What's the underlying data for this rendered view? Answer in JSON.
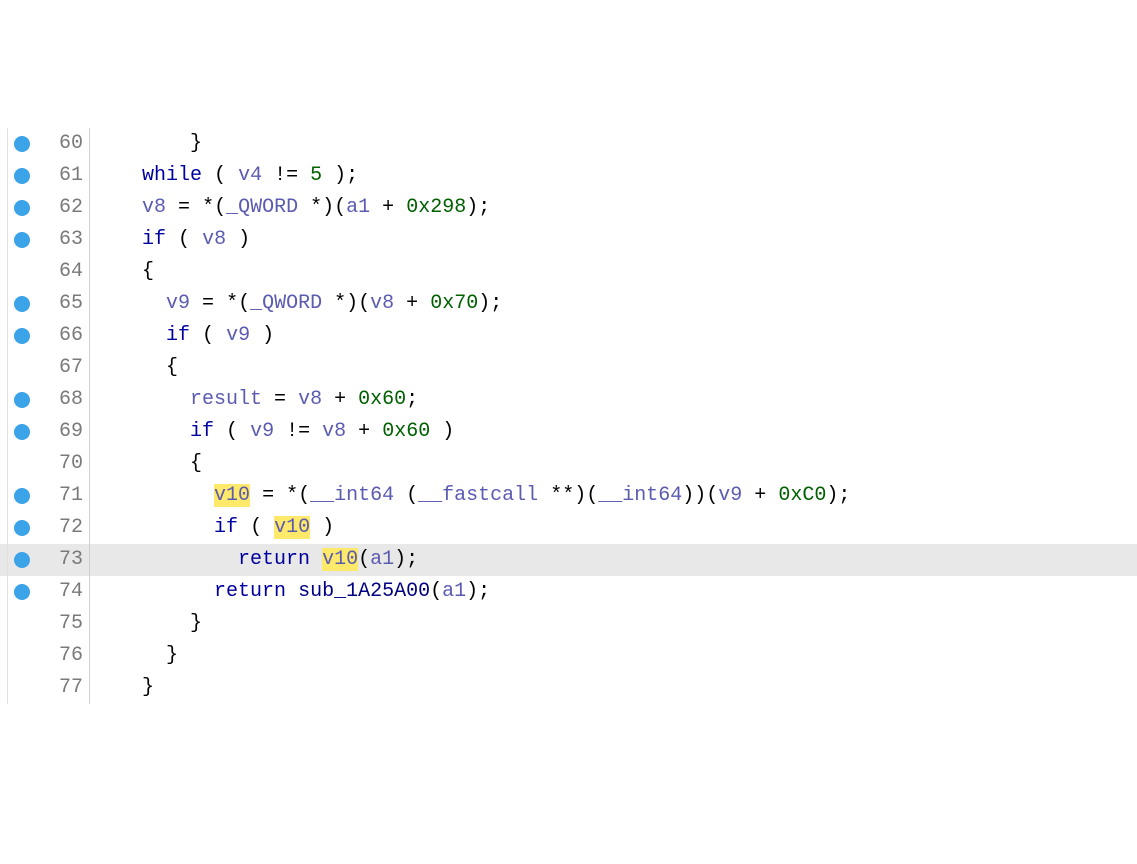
{
  "lines": [
    {
      "num": 60,
      "bp": true,
      "hl": false,
      "tokens": [
        [
          "plain",
          "        "
        ],
        [
          "punc",
          "}"
        ]
      ]
    },
    {
      "num": 61,
      "bp": true,
      "hl": false,
      "tokens": [
        [
          "plain",
          "    "
        ],
        [
          "kw",
          "while"
        ],
        [
          "plain",
          " "
        ],
        [
          "punc",
          "("
        ],
        [
          "plain",
          " "
        ],
        [
          "var",
          "v4"
        ],
        [
          "plain",
          " "
        ],
        [
          "punc",
          "!="
        ],
        [
          "plain",
          " "
        ],
        [
          "num",
          "5"
        ],
        [
          "plain",
          " "
        ],
        [
          "punc",
          ");"
        ]
      ]
    },
    {
      "num": 62,
      "bp": true,
      "hl": false,
      "tokens": [
        [
          "plain",
          "    "
        ],
        [
          "var",
          "v8"
        ],
        [
          "plain",
          " "
        ],
        [
          "punc",
          "="
        ],
        [
          "plain",
          " "
        ],
        [
          "punc",
          "*("
        ],
        [
          "type",
          "_QWORD"
        ],
        [
          "plain",
          " "
        ],
        [
          "punc",
          "*)("
        ],
        [
          "var",
          "a1"
        ],
        [
          "plain",
          " "
        ],
        [
          "punc",
          "+"
        ],
        [
          "plain",
          " "
        ],
        [
          "num",
          "0x298"
        ],
        [
          "punc",
          ");"
        ]
      ]
    },
    {
      "num": 63,
      "bp": true,
      "hl": false,
      "tokens": [
        [
          "plain",
          "    "
        ],
        [
          "kw",
          "if"
        ],
        [
          "plain",
          " "
        ],
        [
          "punc",
          "("
        ],
        [
          "plain",
          " "
        ],
        [
          "var",
          "v8"
        ],
        [
          "plain",
          " "
        ],
        [
          "punc",
          ")"
        ]
      ]
    },
    {
      "num": 64,
      "bp": false,
      "hl": false,
      "tokens": [
        [
          "plain",
          "    "
        ],
        [
          "punc",
          "{"
        ]
      ]
    },
    {
      "num": 65,
      "bp": true,
      "hl": false,
      "tokens": [
        [
          "plain",
          "      "
        ],
        [
          "var",
          "v9"
        ],
        [
          "plain",
          " "
        ],
        [
          "punc",
          "="
        ],
        [
          "plain",
          " "
        ],
        [
          "punc",
          "*("
        ],
        [
          "type",
          "_QWORD"
        ],
        [
          "plain",
          " "
        ],
        [
          "punc",
          "*)("
        ],
        [
          "var",
          "v8"
        ],
        [
          "plain",
          " "
        ],
        [
          "punc",
          "+"
        ],
        [
          "plain",
          " "
        ],
        [
          "num",
          "0x70"
        ],
        [
          "punc",
          ");"
        ]
      ]
    },
    {
      "num": 66,
      "bp": true,
      "hl": false,
      "tokens": [
        [
          "plain",
          "      "
        ],
        [
          "kw",
          "if"
        ],
        [
          "plain",
          " "
        ],
        [
          "punc",
          "("
        ],
        [
          "plain",
          " "
        ],
        [
          "var",
          "v9"
        ],
        [
          "plain",
          " "
        ],
        [
          "punc",
          ")"
        ]
      ]
    },
    {
      "num": 67,
      "bp": false,
      "hl": false,
      "tokens": [
        [
          "plain",
          "      "
        ],
        [
          "punc",
          "{"
        ]
      ]
    },
    {
      "num": 68,
      "bp": true,
      "hl": false,
      "tokens": [
        [
          "plain",
          "        "
        ],
        [
          "var",
          "result"
        ],
        [
          "plain",
          " "
        ],
        [
          "punc",
          "="
        ],
        [
          "plain",
          " "
        ],
        [
          "var",
          "v8"
        ],
        [
          "plain",
          " "
        ],
        [
          "punc",
          "+"
        ],
        [
          "plain",
          " "
        ],
        [
          "num",
          "0x60"
        ],
        [
          "punc",
          ";"
        ]
      ]
    },
    {
      "num": 69,
      "bp": true,
      "hl": false,
      "tokens": [
        [
          "plain",
          "        "
        ],
        [
          "kw",
          "if"
        ],
        [
          "plain",
          " "
        ],
        [
          "punc",
          "("
        ],
        [
          "plain",
          " "
        ],
        [
          "var",
          "v9"
        ],
        [
          "plain",
          " "
        ],
        [
          "punc",
          "!="
        ],
        [
          "plain",
          " "
        ],
        [
          "var",
          "v8"
        ],
        [
          "plain",
          " "
        ],
        [
          "punc",
          "+"
        ],
        [
          "plain",
          " "
        ],
        [
          "num",
          "0x60"
        ],
        [
          "plain",
          " "
        ],
        [
          "punc",
          ")"
        ]
      ]
    },
    {
      "num": 70,
      "bp": false,
      "hl": false,
      "tokens": [
        [
          "plain",
          "        "
        ],
        [
          "punc",
          "{"
        ]
      ]
    },
    {
      "num": 71,
      "bp": true,
      "hl": false,
      "tokens": [
        [
          "plain",
          "          "
        ],
        [
          "hlvar",
          "v10"
        ],
        [
          "plain",
          " "
        ],
        [
          "punc",
          "="
        ],
        [
          "plain",
          " "
        ],
        [
          "punc",
          "*("
        ],
        [
          "type",
          "__int64"
        ],
        [
          "plain",
          " "
        ],
        [
          "punc",
          "("
        ],
        [
          "type",
          "__fastcall"
        ],
        [
          "plain",
          " "
        ],
        [
          "punc",
          "**)("
        ],
        [
          "type",
          "__int64"
        ],
        [
          "punc",
          "))("
        ],
        [
          "var",
          "v9"
        ],
        [
          "plain",
          " "
        ],
        [
          "punc",
          "+"
        ],
        [
          "plain",
          " "
        ],
        [
          "num",
          "0xC0"
        ],
        [
          "punc",
          ");"
        ]
      ]
    },
    {
      "num": 72,
      "bp": true,
      "hl": false,
      "tokens": [
        [
          "plain",
          "          "
        ],
        [
          "kw",
          "if"
        ],
        [
          "plain",
          " "
        ],
        [
          "punc",
          "("
        ],
        [
          "plain",
          " "
        ],
        [
          "hlvar",
          "v10"
        ],
        [
          "plain",
          " "
        ],
        [
          "punc",
          ")"
        ]
      ]
    },
    {
      "num": 73,
      "bp": true,
      "hl": true,
      "tokens": [
        [
          "plain",
          "            "
        ],
        [
          "kw",
          "return"
        ],
        [
          "plain",
          " "
        ],
        [
          "hlvar",
          "v10"
        ],
        [
          "punc",
          "("
        ],
        [
          "var",
          "a1"
        ],
        [
          "punc",
          ");"
        ]
      ]
    },
    {
      "num": 74,
      "bp": true,
      "hl": false,
      "tokens": [
        [
          "plain",
          "          "
        ],
        [
          "kw",
          "return"
        ],
        [
          "plain",
          " "
        ],
        [
          "func",
          "sub_1A25A00"
        ],
        [
          "punc",
          "("
        ],
        [
          "var",
          "a1"
        ],
        [
          "punc",
          ");"
        ]
      ]
    },
    {
      "num": 75,
      "bp": false,
      "hl": false,
      "tokens": [
        [
          "plain",
          "        "
        ],
        [
          "punc",
          "}"
        ]
      ]
    },
    {
      "num": 76,
      "bp": false,
      "hl": false,
      "tokens": [
        [
          "plain",
          "      "
        ],
        [
          "punc",
          "}"
        ]
      ]
    },
    {
      "num": 77,
      "bp": false,
      "hl": false,
      "tokens": [
        [
          "plain",
          "    "
        ],
        [
          "punc",
          "}"
        ]
      ]
    }
  ]
}
